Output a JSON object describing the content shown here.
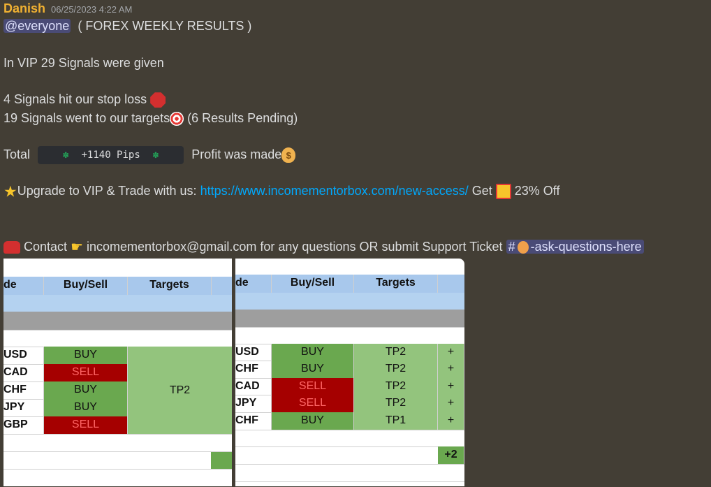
{
  "message": {
    "author": "Danish",
    "timestamp": "06/25/2023 4:22 AM",
    "mention": "@everyone",
    "title": "( FOREX WEEKLY RESULTS )",
    "line_vip": "In VIP 29 Signals were given",
    "line_stop": "4 Signals hit our stop loss",
    "line_targets": "19 Signals went to our targets",
    "line_pending": "(6 Results Pending)",
    "total_label": "Total",
    "pips": "+1140 Pips",
    "clover": "✽",
    "profit": "Profit was made",
    "upgrade": "Upgrade to VIP & Trade with us:",
    "link": "https://www.incomementorbox.com/new-access/",
    "get": "Get",
    "off": "23% Off",
    "contact": "Contact",
    "email_text": "incomementorbox@gmail.com for any questions OR submit Support Ticket",
    "channel_hash": "#",
    "channel": "-ask-questions-here"
  },
  "sheet1": {
    "headers": [
      "de",
      "Buy/Sell",
      "Targets"
    ],
    "rows": [
      {
        "pair": "USD",
        "side": "BUY",
        "type": "buy"
      },
      {
        "pair": "CAD",
        "side": "SELL",
        "type": "sell"
      },
      {
        "pair": "CHF",
        "side": "BUY",
        "type": "buy"
      },
      {
        "pair": "JPY",
        "side": "BUY",
        "type": "buy"
      },
      {
        "pair": "GBP",
        "side": "SELL",
        "type": "sell"
      }
    ],
    "target_merged": "TP2"
  },
  "sheet2": {
    "headers": [
      "de",
      "Buy/Sell",
      "Targets"
    ],
    "rows": [
      {
        "pair": "USD",
        "side": "BUY",
        "target": "TP2",
        "type": "buy",
        "extra": "+"
      },
      {
        "pair": "CHF",
        "side": "BUY",
        "target": "TP2",
        "type": "buy",
        "extra": "+"
      },
      {
        "pair": "CAD",
        "side": "SELL",
        "target": "TP2",
        "type": "sell",
        "extra": "+"
      },
      {
        "pair": "JPY",
        "side": "SELL",
        "target": "TP2",
        "type": "sell",
        "extra": "+"
      },
      {
        "pair": "CHF",
        "side": "BUY",
        "target": "TP1",
        "type": "buy",
        "extra": "+"
      }
    ],
    "total_partial": "+2"
  }
}
